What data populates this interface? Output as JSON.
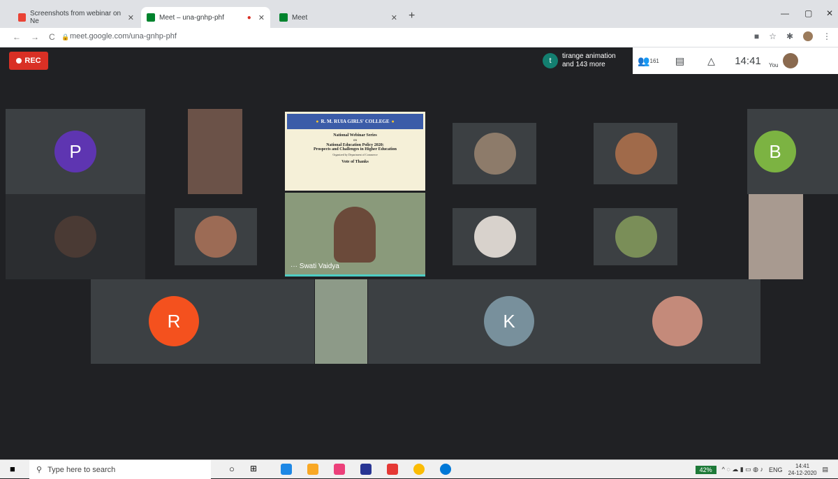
{
  "browser": {
    "tabs": [
      {
        "label": "Screenshots from webinar on Ne",
        "active": false
      },
      {
        "label": "Meet – una-gnhp-phf",
        "active": true
      },
      {
        "label": "Meet",
        "active": false
      }
    ],
    "url": "meet.google.com/una-gnhp-phf"
  },
  "meet": {
    "rec_label": "REC",
    "notification": {
      "initial": "t",
      "line1": "tirange animation",
      "line2": "and 143 more"
    },
    "participant_count": "161",
    "time": "14:41",
    "you_label": "You",
    "tiles": {
      "p": "P",
      "b": "B",
      "r": "R",
      "k": "K"
    },
    "slide": {
      "college": "R. M. RUIA GIRLS' COLLEGE",
      "series": "National Webinar Series",
      "on": "on",
      "policy": "National Education Policy 2020:",
      "topic": "Prospects and Challenges in Higher Education",
      "meta": "Organized by Department of Commerce",
      "vote": "Vote of Thanks"
    },
    "speaker_name": "Swati Vaidya"
  },
  "taskbar": {
    "search_placeholder": "Type here to search",
    "battery": "42%",
    "lang": "ENG",
    "clock_time": "14:41",
    "clock_date": "24-12-2020"
  },
  "colors": {
    "rec": "#d93025",
    "p": "#5e35b1",
    "b": "#7cb342",
    "r": "#f4511e",
    "k": "#78909c"
  }
}
